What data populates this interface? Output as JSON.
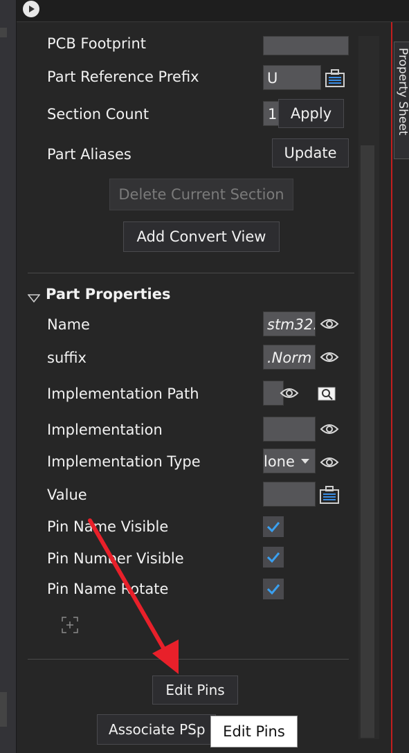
{
  "window": {
    "side_tab_label": "Property Sheet"
  },
  "section": {
    "pcb_footprint_label": "PCB Footprint",
    "pcb_footprint_value": "",
    "part_ref_prefix_label": "Part Reference Prefix",
    "part_ref_prefix_value": "U",
    "section_count_label": "Section Count",
    "section_count_value": "1",
    "apply_label": "Apply",
    "part_aliases_label": "Part Aliases",
    "update_label": "Update",
    "delete_section_label": "Delete Current Section",
    "add_convert_view_label": "Add Convert View"
  },
  "part_properties": {
    "header": "Part Properties",
    "rows": {
      "name": {
        "label": "Name",
        "value": "stm32."
      },
      "suffix": {
        "label": "suffix",
        "value": ".Norm"
      },
      "impl_path": {
        "label": "Implementation Path",
        "value": ""
      },
      "implementation": {
        "label": "Implementation",
        "value": ""
      },
      "impl_type": {
        "label": "Implementation Type",
        "value": "lone"
      },
      "value": {
        "label": "Value",
        "value": ""
      },
      "pin_name_visible": {
        "label": "Pin Name Visible",
        "checked": true
      },
      "pin_number_visible": {
        "label": "Pin Number Visible",
        "checked": true
      },
      "pin_name_rotate": {
        "label": "Pin Name Rotate",
        "checked": true
      }
    }
  },
  "footer": {
    "edit_pins_label": "Edit Pins",
    "associate_label": "Associate PSp"
  },
  "tooltip": {
    "text": "Edit Pins"
  },
  "annotation": {
    "arrow_color": "#e8202a"
  }
}
